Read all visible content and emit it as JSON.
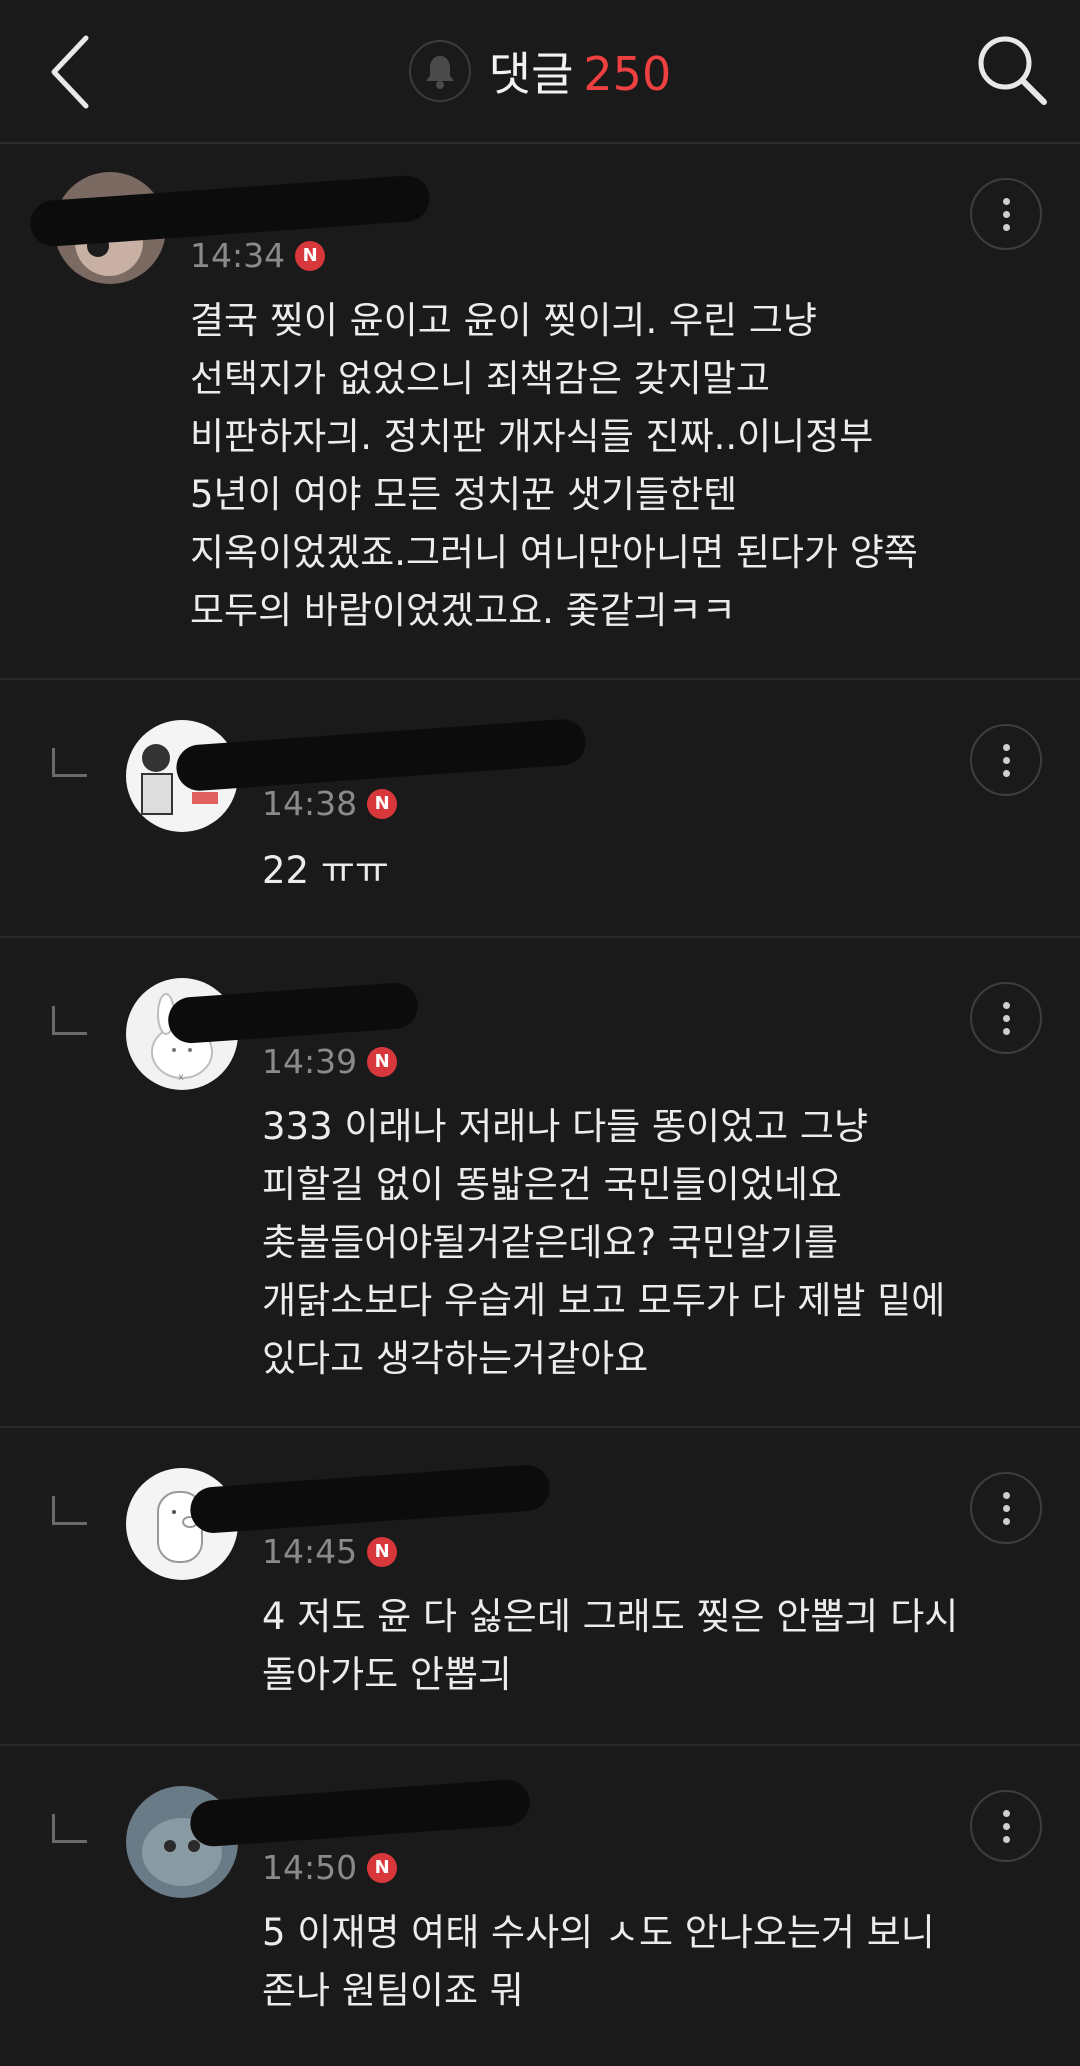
{
  "header": {
    "title": "댓글",
    "count": "250",
    "back_icon": "chevron-left-icon",
    "bell_icon": "bell-icon",
    "search_icon": "search-icon"
  },
  "colors": {
    "accent": "#ee4040",
    "badge": "#d8383c",
    "background": "#1a1a1a"
  },
  "comments": [
    {
      "time": "14:34",
      "badge": "N",
      "lines": [
        "결국 찢이 윤이고 윤이 찢이긔. 우린 그냥",
        "선택지가 없었으니 죄책감은 갖지말고",
        "비판하자긔. 정치판 개자식들 진짜..이니정부",
        "5년이 여야 모든 정치꾼 샛기들한텐",
        "지옥이었겠죠.그러니 여니만아니면 된다가 양쪽",
        "모두의 바람이었겠고요. 좇같긔ㅋㅋ"
      ]
    },
    {
      "time": "14:38",
      "badge": "N",
      "lines": [
        "22 ㅠㅠ"
      ]
    },
    {
      "time": "14:39",
      "badge": "N",
      "lines": [
        "333 이래나 저래나 다들 똥이었고 그냥",
        "피할길 없이 똥밟은건 국민들이었네요",
        "촛불들어야될거같은데요? 국민알기를",
        "개닭소보다 우습게 보고 모두가 다 제발 밑에",
        "있다고 생각하는거같아요"
      ]
    },
    {
      "time": "14:45",
      "badge": "N",
      "lines": [
        "4 저도 윤 다 싫은데 그래도 찢은 안뽑긔 다시",
        "돌아가도 안뽑긔"
      ]
    },
    {
      "time": "14:50",
      "badge": "N",
      "lines": [
        "5 이재명 여태 수사의 ㅅ도 안나오는거 보니",
        "존나 원팀이죠 뭐"
      ]
    }
  ]
}
